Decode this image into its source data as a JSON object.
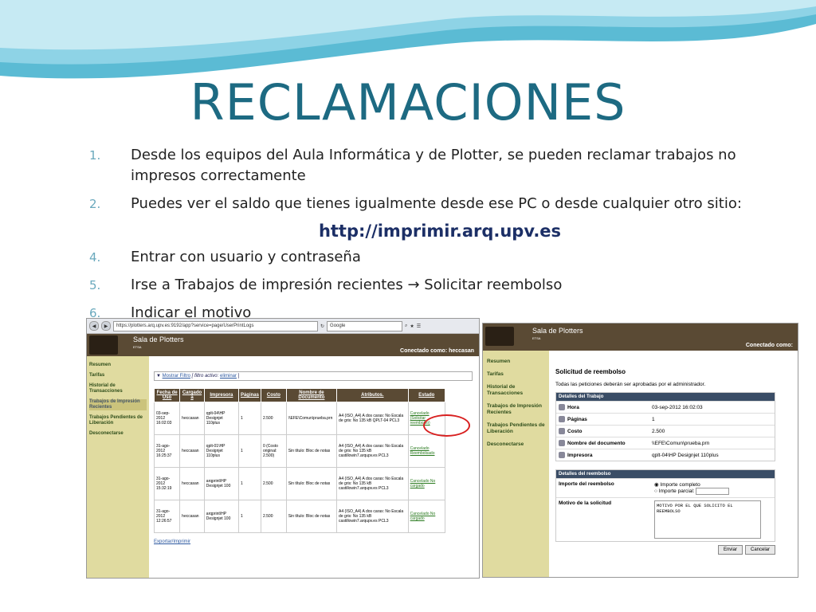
{
  "slide": {
    "title": "RECLAMACIONES",
    "items": [
      {
        "num": "1.",
        "text": "Desde los equipos del Aula Informática y de Plotter, se pueden reclamar trabajos no impresos correctamente"
      },
      {
        "num": "2.",
        "text": "Puedes ver el saldo que tienes igualmente desde ese PC o desde cualquier otro sitio:"
      },
      {
        "num": "4.",
        "text": "Entrar con usuario y contraseña"
      },
      {
        "num": "5.",
        "text": "Irse a Trabajos de impresión recientes → Solicitar reembolso"
      },
      {
        "num": "6.",
        "text": "Indicar el motivo"
      }
    ],
    "url": "http://imprimir.arq.upv.es"
  },
  "shot1": {
    "address": "https://plotters.arq.upv.es:9192/app?service=page/UserPrintLogs",
    "search": "Google",
    "brand": "Sala de Plotters",
    "brand_sub": "ETSA",
    "connected": "Conectado como:  heccasan",
    "nav": [
      "Resumen",
      "Tarifas",
      "Historial de Transacciones",
      "Trabajos de Impresión Recientes",
      "Trabajos Pendientes de Liberación",
      "Desconectarse"
    ],
    "filter": "Mostrar Filtro",
    "filter_rest": "[ filtro activo:",
    "filter_link": "eliminar",
    "headers": [
      "Fecha de Uso",
      "Cargado a",
      "Impresora",
      "Páginas",
      "Costo",
      "Nombre de Documento",
      "Atributos.",
      "Estado"
    ],
    "rows": [
      [
        "03-sep-2012 16:02:03",
        "heccasan",
        "qplt-04\\HP Designjet 110plus",
        "1",
        "2.500",
        "\\\\EFE\\Comun\\prueba.prn",
        "A4 (ISO_A4) A dos caras: No Escala de gris: No 135 kB QPLT-04 PCL3",
        "Cancelado (Solicitar reembolso)"
      ],
      [
        "31-ago-2012 16:25:37",
        "heccasan",
        "qplt-01\\HP Designjet 110plus",
        "1",
        "0 (Costo original: 2.500)",
        "Sin título: Bloc de notas",
        "A4 (ISO_A4) A dos caras: No Escala de gris: No 135 kB castillowin7.arqupv.es PCL3",
        "Cancelado Reembolsado"
      ],
      [
        "31-ago-2012 15:32:19",
        "heccasan",
        "arqprint\\HP Designjet 100",
        "1",
        "2.500",
        "Sin título: Bloc de notas",
        "A4 (ISO_A4) A dos caras: No Escala de gris: No 135 kB castillowin7.arqupv.es PCL3",
        "Cancelado No cargado"
      ],
      [
        "31-ago-2012 12:26:57",
        "heccasan",
        "arqprint\\HP Designjet 100",
        "1",
        "2.500",
        "Sin título: Bloc de notas",
        "A4 (ISO_A4) A dos caras: No Escala de gris: No 135 kB castillowin7.arqupv.es PCL3",
        "Cancelado No cargado"
      ]
    ],
    "export": "Exportar/Imprimir"
  },
  "shot2": {
    "brand": "Sala de Plotters",
    "brand_sub": "ETSA",
    "connected": "Conectado como:",
    "nav": [
      "Resumen",
      "Tarifas",
      "Historial de Transacciones",
      "Trabajos de Impresión Recientes",
      "Trabajos Pendientes de Liberación",
      "Desconectarse"
    ],
    "heading": "Solicitud de reembolso",
    "note": "Todas las peticiones deberán ser aprobadas por el administrador.",
    "details_header": "Detalles del Trabajo",
    "details": [
      {
        "label": "Hora",
        "value": "03-sep-2012 16:02:03"
      },
      {
        "label": "Páginas",
        "value": "1"
      },
      {
        "label": "Costo",
        "value": "2.500"
      },
      {
        "label": "Nombre del documento",
        "value": "\\\\EFE\\Comun\\prueba.prn"
      },
      {
        "label": "Impresora",
        "value": "qplt-04\\HP Designjet 110plus"
      }
    ],
    "refund_header": "Detalles del reembolso",
    "refund_amount_label": "Importe del reembolso",
    "opt_full": "Importe completo",
    "opt_partial": "Importe parcial:",
    "reason_label": "Motivo de la solicitud",
    "reason_text": "MOTIVO POR EL QUE SOLICITO EL REEMBOLSO",
    "send": "Enviar",
    "cancel": "Cancelar"
  }
}
